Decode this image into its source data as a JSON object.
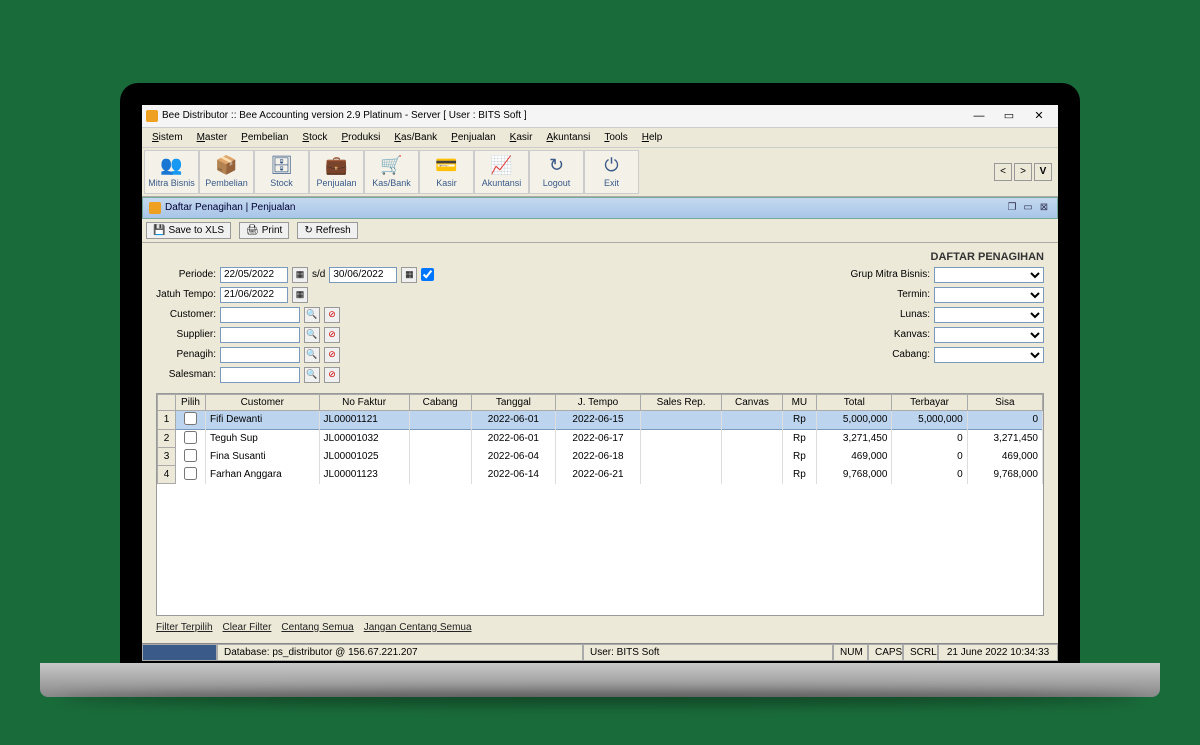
{
  "window": {
    "title": "Bee Distributor :: Bee Accounting version 2.9 Platinum - Server  [ User : BITS Soft ]"
  },
  "menu": [
    "Sistem",
    "Master",
    "Pembelian",
    "Stock",
    "Produksi",
    "Kas/Bank",
    "Penjualan",
    "Kasir",
    "Akuntansi",
    "Tools",
    "Help"
  ],
  "menu_underline": [
    "S",
    "M",
    "P",
    "S",
    "P",
    "K",
    "P",
    "K",
    "A",
    "T",
    "H"
  ],
  "toolbar": [
    {
      "label": "Mitra Bisnis",
      "icon": "👥"
    },
    {
      "label": "Pembelian",
      "icon": "📦"
    },
    {
      "label": "Stock",
      "icon": "🗄"
    },
    {
      "label": "Penjualan",
      "icon": "💼"
    },
    {
      "label": "Kas/Bank",
      "icon": "🛒"
    },
    {
      "label": "Kasir",
      "icon": "💳"
    },
    {
      "label": "Akuntansi",
      "icon": "📈"
    },
    {
      "label": "Logout",
      "icon": "↻"
    },
    {
      "label": "Exit",
      "icon": "⏻"
    }
  ],
  "mdi_title": "Daftar Penagihan | Penjualan",
  "actions": {
    "save": "Save to XLS",
    "print": "Print",
    "refresh": "Refresh"
  },
  "page_title": "DAFTAR PENAGIHAN",
  "filters": {
    "periode_label": "Periode:",
    "periode_from": "22/05/2022",
    "sd": "s/d",
    "periode_to": "30/06/2022",
    "jatuh_label": "Jatuh Tempo:",
    "jatuh_tempo": "21/06/2022",
    "customer_label": "Customer:",
    "customer": "",
    "supplier_label": "Supplier:",
    "supplier": "",
    "penagih_label": "Penagih:",
    "penagih": "",
    "salesman_label": "Salesman:",
    "salesman": "",
    "grup_label": "Grup Mitra Bisnis:",
    "termin_label": "Termin:",
    "lunas_label": "Lunas:",
    "kanvas_label": "Kanvas:",
    "cabang_label": "Cabang:"
  },
  "columns": [
    "Pilih",
    "Customer",
    "No Faktur",
    "Cabang",
    "Tanggal",
    "J. Tempo",
    "Sales Rep.",
    "Canvas",
    "MU",
    "Total",
    "Terbayar",
    "Sisa"
  ],
  "rows": [
    {
      "n": "1",
      "customer": "Fifi Dewanti",
      "faktur": "JL00001121",
      "cabang": "",
      "tanggal": "2022-06-01",
      "jtempo": "2022-06-15",
      "sales": "",
      "canvas": "",
      "mu": "Rp",
      "total": "5,000,000",
      "terbayar": "5,000,000",
      "sisa": "0",
      "selected": true
    },
    {
      "n": "2",
      "customer": "Teguh Sup",
      "faktur": "JL00001032",
      "cabang": "",
      "tanggal": "2022-06-01",
      "jtempo": "2022-06-17",
      "sales": "",
      "canvas": "",
      "mu": "Rp",
      "total": "3,271,450",
      "terbayar": "0",
      "sisa": "3,271,450"
    },
    {
      "n": "3",
      "customer": "Fina Susanti",
      "faktur": "JL00001025",
      "cabang": "",
      "tanggal": "2022-06-04",
      "jtempo": "2022-06-18",
      "sales": "",
      "canvas": "",
      "mu": "Rp",
      "total": "469,000",
      "terbayar": "0",
      "sisa": "469,000"
    },
    {
      "n": "4",
      "customer": "Farhan Anggara",
      "faktur": "JL00001123",
      "cabang": "",
      "tanggal": "2022-06-14",
      "jtempo": "2022-06-21",
      "sales": "",
      "canvas": "",
      "mu": "Rp",
      "total": "9,768,000",
      "terbayar": "0",
      "sisa": "9,768,000"
    }
  ],
  "links": {
    "filter": "Filter Terpilih",
    "clear": "Clear Filter",
    "centang": "Centang Semua",
    "jangan": "Jangan Centang Semua"
  },
  "status": {
    "db": "Database: ps_distributor @ 156.67.221.207",
    "user": "User: BITS Soft",
    "num": "NUM",
    "caps": "CAPS",
    "scrl": "SCRL",
    "time": "21 June 2022  10:34:33"
  }
}
